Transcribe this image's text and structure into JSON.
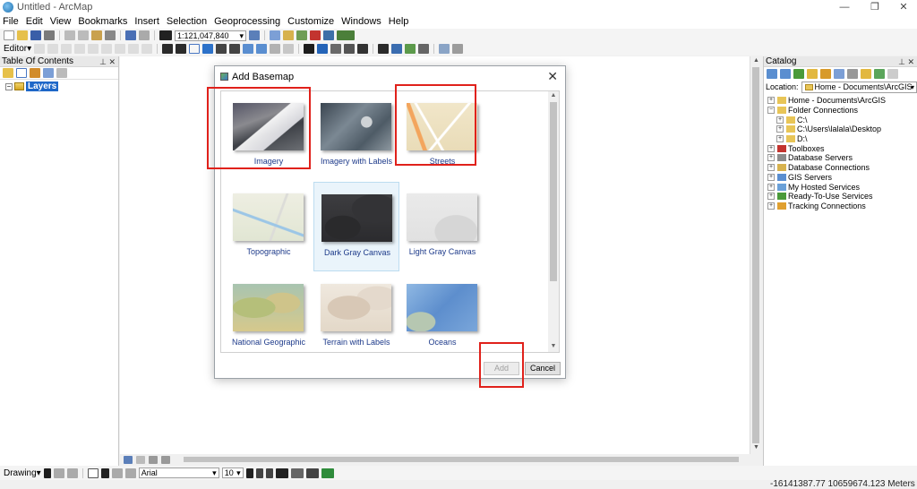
{
  "window": {
    "title": "Untitled - ArcMap",
    "controls": [
      "—",
      "❐",
      "✕"
    ]
  },
  "menu": [
    "File",
    "Edit",
    "View",
    "Bookmarks",
    "Insert",
    "Selection",
    "Geoprocessing",
    "Customize",
    "Windows",
    "Help"
  ],
  "toolbar": {
    "scale": "1:121,047,840",
    "editor_label": "Editor▾"
  },
  "toc": {
    "title": "Table Of Contents",
    "layers_label": "Layers"
  },
  "catalog": {
    "title": "Catalog",
    "location_label": "Location:",
    "location_value": "Home - Documents\\ArcGIS",
    "tree": [
      {
        "label": "Home - Documents\\ArcGIS",
        "level": 0,
        "expander": "+"
      },
      {
        "label": "Folder Connections",
        "level": 0,
        "expander": "−"
      },
      {
        "label": "C:\\",
        "level": 1,
        "expander": "+"
      },
      {
        "label": "C:\\Users\\lalala\\Desktop",
        "level": 1,
        "expander": "+"
      },
      {
        "label": "D:\\",
        "level": 1,
        "expander": "+"
      },
      {
        "label": "Toolboxes",
        "level": 0,
        "expander": "+"
      },
      {
        "label": "Database Servers",
        "level": 0,
        "expander": "+"
      },
      {
        "label": "Database Connections",
        "level": 0,
        "expander": "+"
      },
      {
        "label": "GIS Servers",
        "level": 0,
        "expander": "+"
      },
      {
        "label": "My Hosted Services",
        "level": 0,
        "expander": "+"
      },
      {
        "label": "Ready-To-Use Services",
        "level": 0,
        "expander": "+"
      },
      {
        "label": "Tracking Connections",
        "level": 0,
        "expander": "+"
      }
    ]
  },
  "dialog": {
    "title": "Add Basemap",
    "close": "✕",
    "basemaps": [
      {
        "label": "Imagery",
        "style": "img-imagery",
        "selected": false
      },
      {
        "label": "Imagery with Labels",
        "style": "img-imagery-labels",
        "selected": false
      },
      {
        "label": "Streets",
        "style": "img-streets",
        "selected": false
      },
      {
        "label": "Topographic",
        "style": "img-topographic",
        "selected": false
      },
      {
        "label": "Dark Gray Canvas",
        "style": "img-darkgray",
        "selected": true
      },
      {
        "label": "Light Gray Canvas",
        "style": "img-lightgray",
        "selected": false
      },
      {
        "label": "National Geographic",
        "style": "img-natgeo",
        "selected": false
      },
      {
        "label": "Terrain with Labels",
        "style": "img-terrain",
        "selected": false
      },
      {
        "label": "Oceans",
        "style": "img-oceans",
        "selected": false
      }
    ],
    "add_label": "Add",
    "cancel_label": "Cancel"
  },
  "drawing": {
    "label": "Drawing▾",
    "font": "Arial",
    "size": "10"
  },
  "status": {
    "coords": "-16141387.77  10659674.123 Meters"
  },
  "colors": {
    "highlight": "#e0211b",
    "selection": "#1e67c8"
  }
}
